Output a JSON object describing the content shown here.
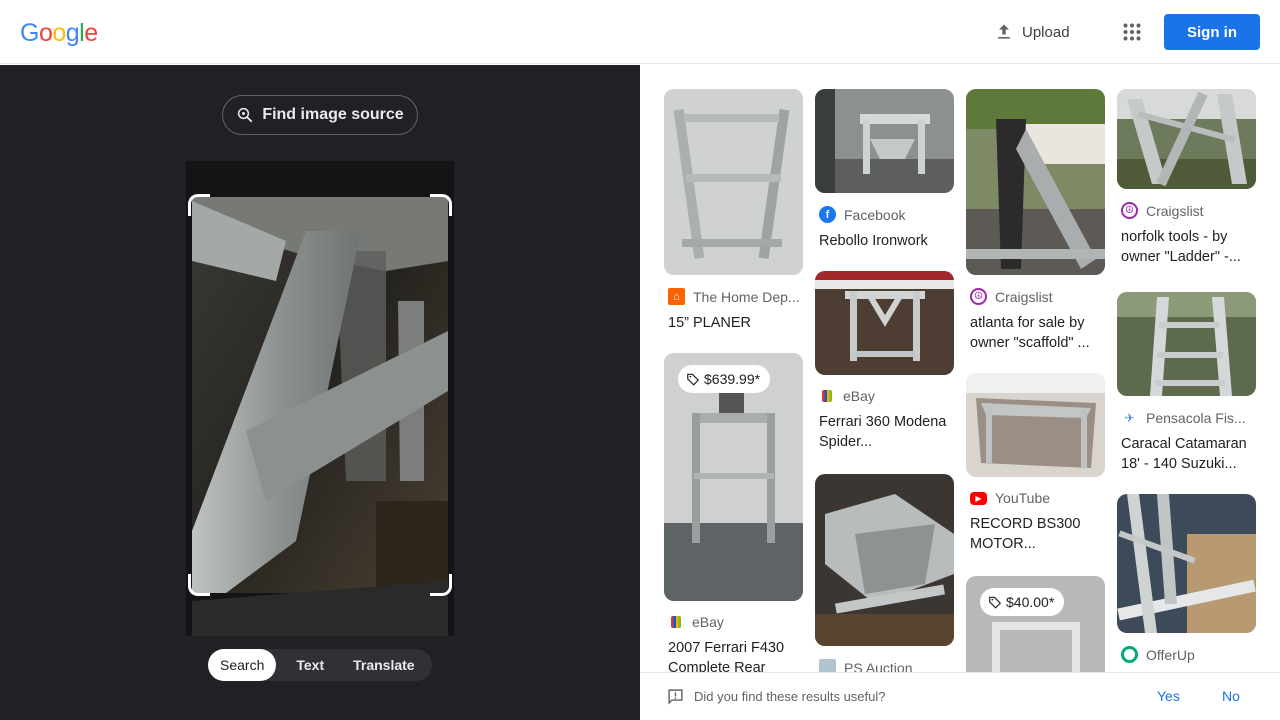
{
  "header": {
    "logo": [
      "G",
      "o",
      "o",
      "g",
      "l",
      "e"
    ],
    "logo_colors": [
      "#4285f4",
      "#ea4335",
      "#fbbc05",
      "#4285f4",
      "#34a853",
      "#ea4335"
    ],
    "upload_label": "Upload",
    "signin_label": "Sign in"
  },
  "lens": {
    "find_source_label": "Find image source",
    "tabs": [
      "Search",
      "Text",
      "Translate"
    ],
    "active_tab": "Search"
  },
  "results": [
    {
      "source": "The Home Dep...",
      "title": "15” PLANER",
      "favicon": "home-depot-icon",
      "color": "#f96302"
    },
    {
      "source": "eBay",
      "title": "2007 Ferrari F430 Complete Rear",
      "favicon": "ebay-icon",
      "price": "$639.99*"
    },
    {
      "source": "Facebook",
      "title": "Rebollo Ironwork",
      "favicon": "facebook-icon",
      "color": "#1877f2"
    },
    {
      "source": "eBay",
      "title": "Ferrari 360 Modena Spider...",
      "favicon": "ebay-icon"
    },
    {
      "source": "PS Auction",
      "title": "",
      "favicon": "ps-auction-icon"
    },
    {
      "source": "Craigslist",
      "title": "atlanta for sale by owner \"scaffold\" ...",
      "favicon": "craigslist-icon",
      "color": "#9c27b0"
    },
    {
      "source": "YouTube",
      "title": "RECORD BS300 MOTOR...",
      "favicon": "youtube-icon",
      "color": "#ff0000"
    },
    {
      "source": "",
      "title": "",
      "favicon": "",
      "price": "$40.00*"
    },
    {
      "source": "Craigslist",
      "title": "norfolk tools - by owner \"Ladder\" -...",
      "favicon": "craigslist-icon",
      "color": "#9c27b0"
    },
    {
      "source": "Pensacola Fis...",
      "title": "Caracal Catamaran 18' - 140 Suzuki...",
      "favicon": "pensacola-icon"
    },
    {
      "source": "OfferUp",
      "title": "",
      "favicon": "offerup-icon",
      "color": "#00a87e"
    }
  ],
  "feedback": {
    "question": "Did you find these results useful?",
    "yes": "Yes",
    "no": "No"
  }
}
